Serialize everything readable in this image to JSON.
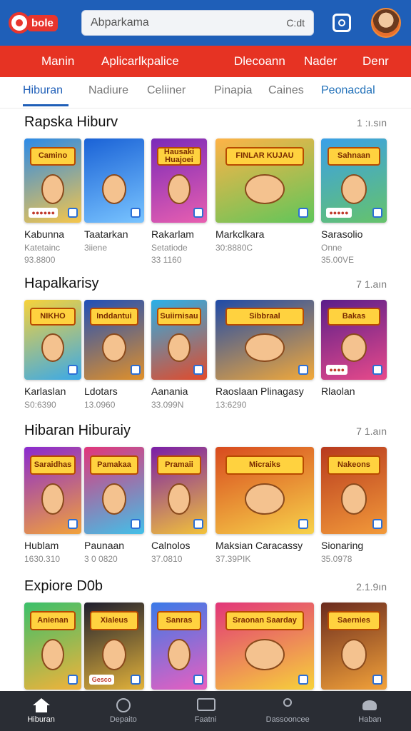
{
  "header": {
    "logo_text": "bole",
    "search_text": "Abparkama",
    "search_right": "C:dt",
    "icon_square": "square-icon",
    "avatar": "avatar"
  },
  "rednav": [
    "Manin",
    "Aplicarlkpalice",
    "Dlecoann",
    "Nader",
    "Denr"
  ],
  "tabs": [
    "Hiburan",
    "Nadiure",
    "Celiiner",
    "Pinapia",
    "Caines",
    "Peonacdal"
  ],
  "sections": [
    {
      "title": "Rapska Hiburv",
      "more": "1 :ı.sın",
      "cards": [
        {
          "name": "Kabunna",
          "sub": "Katetainc",
          "meta": "93.8800",
          "banner": "Camino",
          "tag": "●●●●●●",
          "c1": "#2b8ae8",
          "c2": "#f6c64a"
        },
        {
          "name": "Taatarkan",
          "sub": "3iiene",
          "meta": "",
          "banner": "",
          "tag": "",
          "c1": "#1a62d6",
          "c2": "#79c4ff"
        },
        {
          "name": "Rakarlam",
          "sub": "Setatiode",
          "meta": "33 1160",
          "banner": "Hausaki Huajoei",
          "tag": "",
          "c1": "#7a2ab8",
          "c2": "#e85fb0"
        },
        {
          "name": "Markclkara",
          "sub": "30:8880C",
          "meta": "",
          "banner": "FINLAR KUJAU",
          "tag": "",
          "c1": "#ffb347",
          "c2": "#5fc65a"
        },
        {
          "name": "Sarasolio",
          "sub": "Onne",
          "meta": "35.00VE",
          "banner": "Sahnaan",
          "tag": "●●●●●",
          "c1": "#3aa0e8",
          "c2": "#66c36a"
        }
      ]
    },
    {
      "title": "Hapalkarisy",
      "more": "7 1.aın",
      "cards": [
        {
          "name": "Karlaslan",
          "sub": "S0:6390",
          "meta": "",
          "banner": "NIKHO",
          "tag": "",
          "c1": "#f7d23a",
          "c2": "#3aa9e8"
        },
        {
          "name": "Ldotars",
          "sub": "13.0960",
          "meta": "",
          "banner": "Inddantui",
          "tag": "",
          "c1": "#1f4fb8",
          "c2": "#e0902a"
        },
        {
          "name": "Aanania",
          "sub": "33.099N",
          "meta": "",
          "banner": "Suiirnisau",
          "tag": "",
          "c1": "#2ab0e8",
          "c2": "#e24a2a"
        },
        {
          "name": "Raoslaan Plinagasy",
          "sub": "13:6290",
          "meta": "",
          "banner": "Sibbraal",
          "tag": "",
          "c1": "#1e4aa8",
          "c2": "#f2a93a"
        },
        {
          "name": "Rlaolan",
          "sub": "",
          "meta": "",
          "banner": "Bakas",
          "tag": "●●●●",
          "c1": "#5a1e8a",
          "c2": "#e84a8a"
        }
      ]
    },
    {
      "title": "Hibaran Hiburaiy",
      "more": "7 1.aın",
      "cards": [
        {
          "name": "Hublam",
          "sub": "1630.310",
          "meta": "",
          "banner": "Saraidhas",
          "tag": "",
          "c1": "#8a2ad0",
          "c2": "#f2a23a"
        },
        {
          "name": "Paunaan",
          "sub": "3 0 0820",
          "meta": "",
          "banner": "Pamakaa",
          "tag": "",
          "c1": "#e2357a",
          "c2": "#42c0e8"
        },
        {
          "name": "Calnolos",
          "sub": "37.0810",
          "meta": "",
          "banner": "Pramaii",
          "tag": "",
          "c1": "#7a1ea8",
          "c2": "#f2c23a"
        },
        {
          "name": "Maksian Caracassy",
          "sub": "37.39PIK",
          "meta": "",
          "banner": "Micraiks",
          "tag": "",
          "c1": "#d84a1e",
          "c2": "#f7d24a"
        },
        {
          "name": "Sionaring",
          "sub": "35.0978",
          "meta": "",
          "banner": "Nakeons",
          "tag": "",
          "c1": "#b83a1e",
          "c2": "#f29a3a"
        }
      ]
    },
    {
      "title": "Expiore D0b",
      "more": "2.1.9ın",
      "cards": [
        {
          "name": "",
          "sub": "",
          "meta": "",
          "banner": "Anienan",
          "tag": "",
          "c1": "#3ac06a",
          "c2": "#f2b23a"
        },
        {
          "name": "",
          "sub": "",
          "meta": "",
          "banner": "Xialeus",
          "tag": "Gesco",
          "c1": "#1e1e2e",
          "c2": "#e2b23a"
        },
        {
          "name": "",
          "sub": "",
          "meta": "",
          "banner": "Sanras",
          "tag": "",
          "c1": "#3a7ae8",
          "c2": "#e85fc0"
        },
        {
          "name": "",
          "sub": "",
          "meta": "",
          "banner": "Sraonan Saarday",
          "tag": "",
          "c1": "#e2357a",
          "c2": "#f7d23a"
        },
        {
          "name": "",
          "sub": "",
          "meta": "",
          "banner": "Saernies",
          "tag": "",
          "c1": "#6a2a1e",
          "c2": "#f2a23a"
        }
      ]
    }
  ],
  "bottomnav": [
    {
      "label": "Hiburan",
      "icon": "home-icon",
      "active": true
    },
    {
      "label": "Depaito",
      "icon": "compass-icon",
      "active": false
    },
    {
      "label": "Faatni",
      "icon": "card-icon",
      "active": false
    },
    {
      "label": "Dassooncee",
      "icon": "user-icon",
      "active": false
    },
    {
      "label": "Haban",
      "icon": "stack-icon",
      "active": false
    }
  ]
}
